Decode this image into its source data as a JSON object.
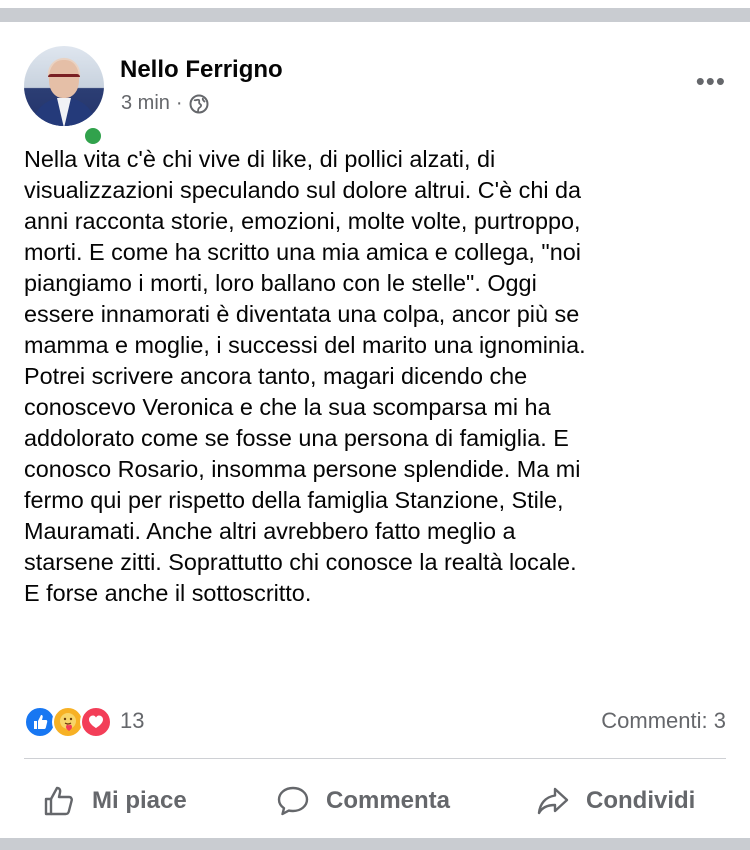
{
  "post": {
    "author": "Nello Ferrigno",
    "time": "3 min",
    "separator": "·",
    "privacy_icon": "globe-icon",
    "more_label": "•••",
    "text": "Nella vita c'è chi vive di like, di pollici alzati, di\nvisualizzazioni speculando sul dolore altrui. C'è chi da\nanni racconta storie, emozioni, molte volte, purtroppo,\nmorti. E come ha scritto una mia amica e collega, \"noi\npiangiamo i morti, loro ballano con le stelle\".  Oggi\nessere innamorati è diventata una colpa, ancor più se\nmamma e moglie, i successi del marito una ignominia.\nPotrei scrivere ancora tanto, magari dicendo che\nconoscevo Veronica e che la sua scomparsa mi ha\naddolorato come se fosse una persona di famiglia. E\nconosco Rosario, insomma persone splendide. Ma mi\nfermo qui per rispetto della famiglia Stanzione, Stile,\nMauramati. Anche altri avrebbero fatto meglio a\nstarsene zitti. Soprattutto chi conosce la realtà locale.\nE forse anche il sottoscritto."
  },
  "reactions": {
    "icons": [
      "like-reaction-icon",
      "care-reaction-icon",
      "love-reaction-icon"
    ],
    "count": "13",
    "comments": "Commenti: 3"
  },
  "actions": {
    "like": "Mi piace",
    "comment": "Commenta",
    "share": "Condividi"
  },
  "colors": {
    "background": "#ffffff",
    "band": "#c9ccd1",
    "secondary_text": "#65676b",
    "online": "#31a24c",
    "like_blue": "#1877f2",
    "care_yellow": "#f7b125",
    "love_red": "#f33e58"
  }
}
